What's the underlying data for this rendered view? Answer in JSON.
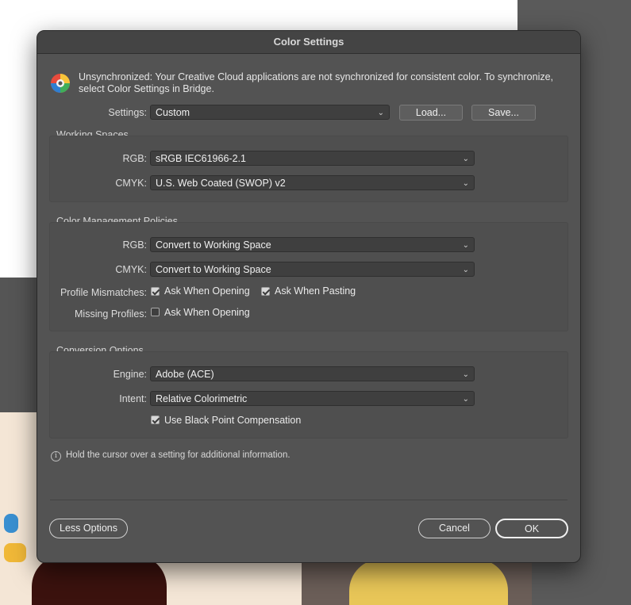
{
  "window": {
    "title": "Color Settings"
  },
  "info": {
    "icon": "creative-cloud-icon",
    "message": "Unsynchronized: Your Creative Cloud applications are not synchronized for consistent color. To synchronize, select Color Settings in Bridge."
  },
  "settings": {
    "label": "Settings:",
    "value": "Custom",
    "load_label": "Load...",
    "save_label": "Save..."
  },
  "working_spaces": {
    "title": "Working Spaces",
    "rgb_label": "RGB:",
    "rgb_value": "sRGB IEC61966-2.1",
    "cmyk_label": "CMYK:",
    "cmyk_value": "U.S. Web Coated (SWOP) v2"
  },
  "policies": {
    "title": "Color Management Policies",
    "rgb_label": "RGB:",
    "rgb_value": "Convert to Working Space",
    "cmyk_label": "CMYK:",
    "cmyk_value": "Convert to Working Space",
    "mismatch_label": "Profile Mismatches:",
    "mismatch_open_label": "Ask When Opening",
    "mismatch_open_checked": true,
    "mismatch_paste_label": "Ask When Pasting",
    "mismatch_paste_checked": true,
    "missing_label": "Missing Profiles:",
    "missing_open_label": "Ask When Opening",
    "missing_open_checked": false
  },
  "conversion": {
    "title": "Conversion Options",
    "engine_label": "Engine:",
    "engine_value": "Adobe (ACE)",
    "intent_label": "Intent:",
    "intent_value": "Relative Colorimetric",
    "bpc_label": "Use Black Point Compensation",
    "bpc_checked": true
  },
  "hint": {
    "icon": "info-icon",
    "text": "Hold the cursor over a setting for additional information."
  },
  "footer": {
    "less_options_label": "Less Options",
    "cancel_label": "Cancel",
    "ok_label": "OK"
  }
}
